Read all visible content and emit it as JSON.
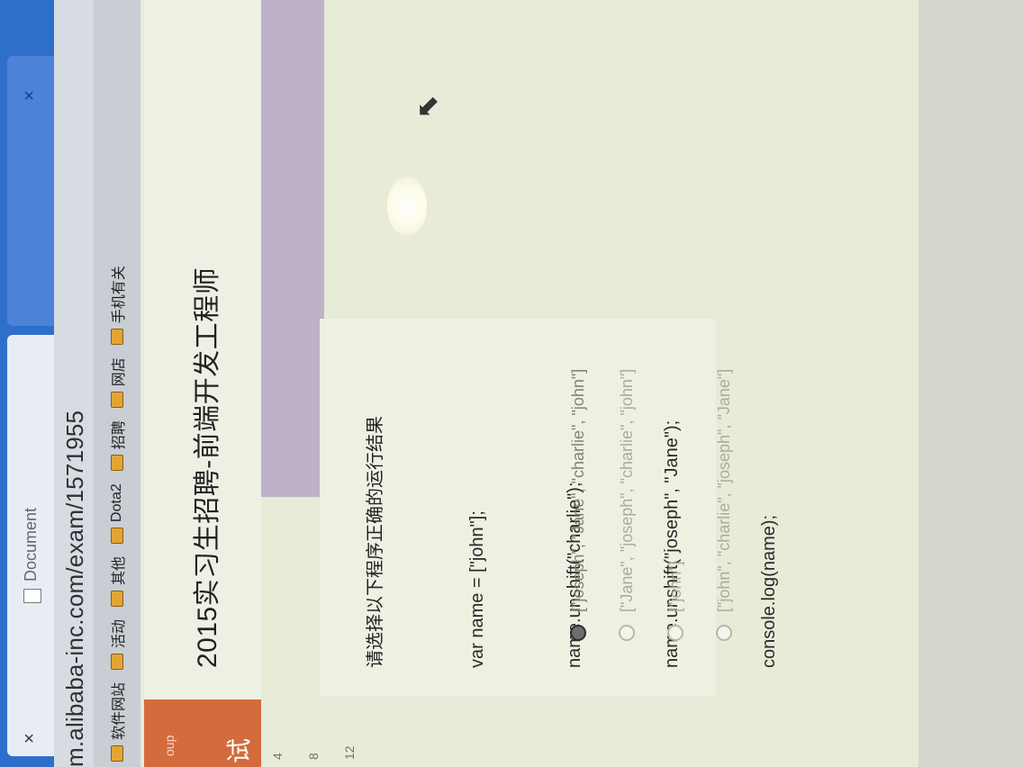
{
  "browser": {
    "tabs": [
      {
        "title": "Document",
        "close": "×"
      },
      {
        "title": "",
        "close": "×"
      }
    ],
    "address": "m.alibaba-inc.com/exam/1571955",
    "bookmarks": [
      "软件网站",
      "活动",
      "其他",
      "Dota2",
      "招聘",
      "网店",
      "手机有关"
    ]
  },
  "page": {
    "headline": "2015实习生招聘-前端开发工程师",
    "left_panel": {
      "small": "oup",
      "big": "试",
      "numbers": [
        "4",
        "8",
        "12"
      ]
    },
    "question": {
      "prompt": "请选择以下程序正确的运行结果",
      "code_lines": [
        "var name = [\"john\"];",
        "name.unshift(\"charlie\");",
        "name.unshift(\"joseph\", \"Jane\");",
        "console.log(name);"
      ],
      "options": [
        "[\"joseph\", \"Jane\", \"charlie\", \"john\"]",
        "[\"Jane\", \"joseph\", \"charlie\", \"john\"]",
        "[\"john\"]",
        "[\"john\", \"charlie\", \"joseph\", \"Jane\"]"
      ],
      "selected_index": 0
    }
  },
  "colors": {
    "tabbar": "#2f6fcc",
    "orange": "#d36b3c",
    "page_bg": "#e7ebd8",
    "purple": "#bdb2c8",
    "folder": "#e2a534"
  },
  "icons": [
    "document-icon",
    "folder-icon",
    "radio-icon",
    "mouse-pointer-icon"
  ]
}
